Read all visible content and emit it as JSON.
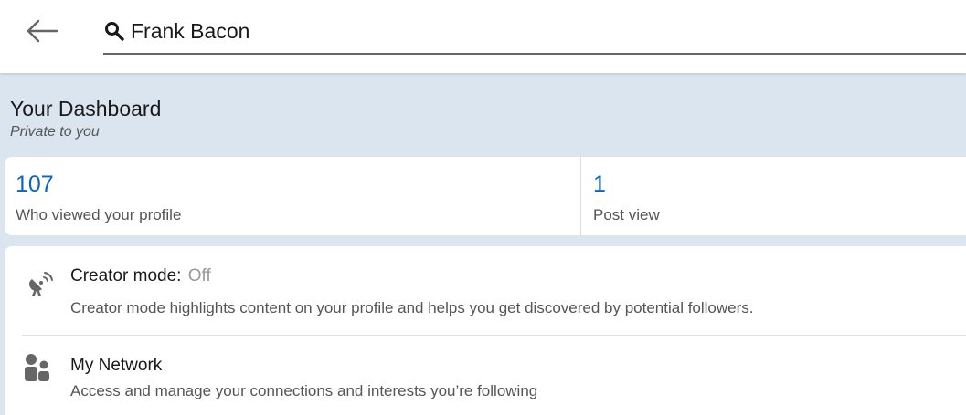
{
  "search": {
    "value": "Frank Bacon",
    "back_icon": "arrow-left-icon",
    "search_icon": "magnifier-icon"
  },
  "dashboard": {
    "title": "Your Dashboard",
    "subtitle": "Private to you",
    "stats": [
      {
        "value": "107",
        "label": "Who viewed your profile"
      },
      {
        "value": "1",
        "label": "Post view"
      }
    ],
    "items": [
      {
        "icon": "satellite-dish-icon",
        "title": "Creator mode:",
        "status": "Off",
        "description": "Creator mode highlights content on your profile and helps you get discovered by potential followers."
      },
      {
        "icon": "people-icon",
        "title": "My Network",
        "description": "Access and manage your connections and interests you’re following"
      }
    ]
  },
  "colors": {
    "accent": "#0a66c2",
    "background": "#dbe5ef",
    "text_primary": "#191919",
    "text_secondary": "#555555",
    "status_off": "#999999"
  }
}
